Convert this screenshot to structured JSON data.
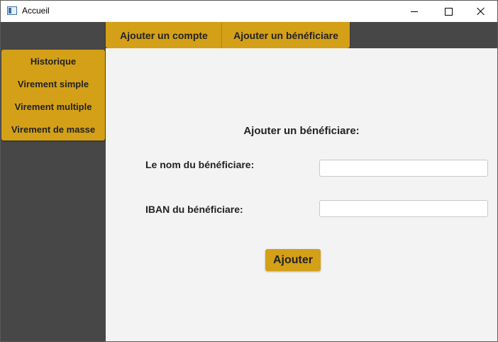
{
  "window": {
    "title": "Accueil"
  },
  "topbar": {
    "tabs": [
      {
        "label": "Ajouter un compte"
      },
      {
        "label": "Ajouter un bénéficiare"
      }
    ]
  },
  "sidebar": {
    "items": [
      {
        "label": "Historique"
      },
      {
        "label": "Virement simple"
      },
      {
        "label": "Virement multiple"
      },
      {
        "label": "Virement de masse"
      }
    ]
  },
  "form": {
    "title": "Ajouter un bénéficiare:",
    "name_label": "Le nom du bénéficiare:",
    "name_value": "",
    "iban_label": "IBAN du bénéficiare:",
    "iban_value": "",
    "submit_label": "Ajouter"
  },
  "colors": {
    "accent": "#d4a017",
    "sidebar_bg": "#474747",
    "content_bg": "#f3f3f3"
  }
}
